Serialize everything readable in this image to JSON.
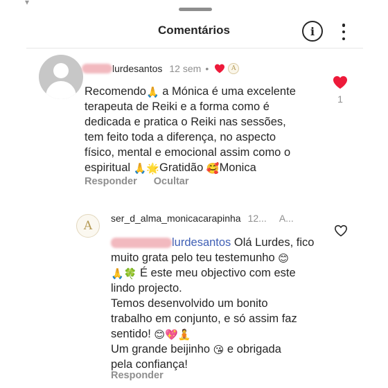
{
  "header": {
    "title": "Comentários"
  },
  "comment1": {
    "username": "lurdesantos",
    "time": "12 sem",
    "dot": "•",
    "lines": [
      "Recomendo",
      " a Mónica é uma excelente",
      "terapeuta de Reiki e a forma como é",
      "dedicada e pratica o Reiki nas sessões,",
      "tem feito toda a diferença, no aspecto",
      "físico, mental e emocional assim como o",
      "espiritual ",
      "Gratidão ",
      "Monica"
    ],
    "like_count": "1",
    "reply_label": "Responder",
    "hide_label": "Ocultar"
  },
  "comment2": {
    "username": "ser_d_alma_monicacarapinha",
    "time": "12...",
    "ellipsis": "A...",
    "mention": "lurdesantos",
    "lines": [
      " Olá Lurdes, fico",
      "muito grata pelo teu testemunho ",
      " É este meu objectivo com este",
      "lindo projecto.",
      "Temos desenvolvido um bonito",
      "trabalho em conjunto, e só assim faz",
      "sentido! ",
      "Um grande beijinho ",
      " e obrigada",
      "pela confiança!"
    ],
    "reply_label": "Responder"
  },
  "colors": {
    "heart": "#ed1a3a",
    "meta": "#8e8e8e",
    "mention": "#3f5fb5"
  },
  "icons": [
    "info-icon",
    "more-icon",
    "heart-icon",
    "heart-outline-icon",
    "pray-emoji",
    "sparkle-emoji",
    "love-face-emoji",
    "clover-emoji",
    "smile-emoji",
    "hearts-emoji",
    "person-emoji",
    "kiss-emoji"
  ]
}
